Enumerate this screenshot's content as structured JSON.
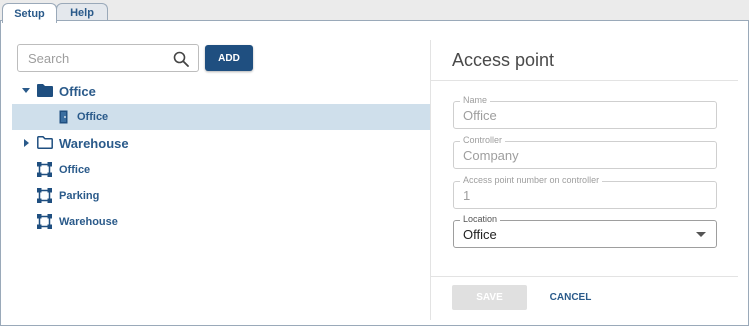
{
  "tabs": [
    {
      "label": "Setup",
      "active": true
    },
    {
      "label": "Help",
      "active": false
    }
  ],
  "search": {
    "placeholder": "Search",
    "value": ""
  },
  "add_label": "ADD",
  "tree": {
    "office_group": {
      "label": "Office",
      "expanded": true,
      "icon": "folder-filled-icon"
    },
    "office_door": {
      "label": "Office",
      "icon": "door-icon",
      "selected": true
    },
    "warehouse_group": {
      "label": "Warehouse",
      "expanded": false,
      "icon": "folder-outline-icon"
    },
    "office_zone": {
      "label": "Office",
      "icon": "zone-icon"
    },
    "parking_zone": {
      "label": "Parking",
      "icon": "zone-icon"
    },
    "warehouse_zone": {
      "label": "Warehouse",
      "icon": "zone-icon"
    }
  },
  "panel": {
    "title": "Access point",
    "fields": {
      "name": {
        "label": "Name",
        "value": "Office"
      },
      "controller": {
        "label": "Controller",
        "value": "Company"
      },
      "number": {
        "label": "Access point number on controller",
        "value": "1"
      },
      "location": {
        "label": "Location",
        "value": "Office"
      }
    },
    "save_label": "SAVE",
    "cancel_label": "CANCEL"
  },
  "colors": {
    "accent": "#1f4f80",
    "tree_text": "#2a5a8a",
    "selected_row": "#cfdfeb"
  }
}
